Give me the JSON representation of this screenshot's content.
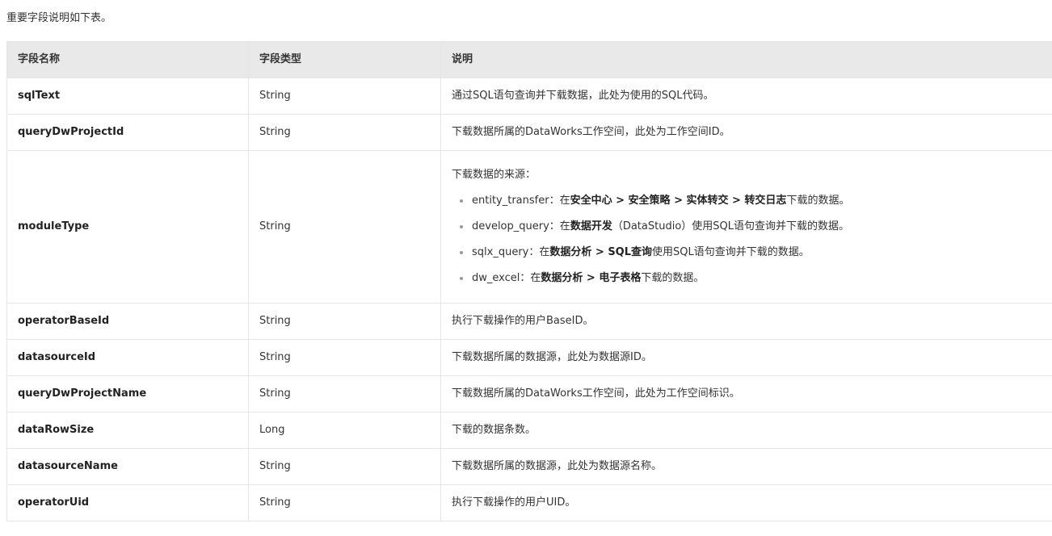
{
  "intro": "重要字段说明如下表。",
  "table": {
    "headers": [
      "字段名称",
      "字段类型",
      "说明"
    ],
    "rows": [
      {
        "name": "sqlText",
        "type": "String",
        "desc": "通过SQL语句查询并下载数据，此处为使用的SQL代码。"
      },
      {
        "name": "queryDwProjectId",
        "type": "String",
        "desc": "下载数据所属的DataWorks工作空间，此处为工作空间ID。"
      },
      {
        "name": "moduleType",
        "type": "String",
        "desc_lead": "下载数据的来源：",
        "items": [
          {
            "key": "entity_transfer：",
            "pre": "在",
            "b1": "安全中心 > 安全策略 > 实体转交 > 转交日志",
            "mid": "",
            "b2": "",
            "post": "下载的数据。"
          },
          {
            "key": "develop_query：",
            "pre": "在",
            "b1": "数据开发",
            "mid": "（DataStudio）使用SQL语句查询并下载的数据。",
            "b2": "",
            "post": ""
          },
          {
            "key": "sqlx_query：",
            "pre": "在",
            "b1": "数据分析 > SQL查询",
            "mid": "使用SQL语句查询并下载的数据。",
            "b2": "",
            "post": ""
          },
          {
            "key": "dw_excel：",
            "pre": "在",
            "b1": "数据分析 > 电子表格",
            "mid": "下载的数据。",
            "b2": "",
            "post": ""
          }
        ]
      },
      {
        "name": "operatorBaseId",
        "type": "String",
        "desc": "执行下载操作的用户BaseID。"
      },
      {
        "name": "datasourceId",
        "type": "String",
        "desc": "下载数据所属的数据源，此处为数据源ID。"
      },
      {
        "name": "queryDwProjectName",
        "type": "String",
        "desc": "下载数据所属的DataWorks工作空间，此处为工作空间标识。"
      },
      {
        "name": "dataRowSize",
        "type": "Long",
        "desc": "下载的数据条数。"
      },
      {
        "name": "datasourceName",
        "type": "String",
        "desc": "下载数据所属的数据源，此处为数据源名称。"
      },
      {
        "name": "operatorUid",
        "type": "String",
        "desc": "执行下载操作的用户UID。"
      }
    ]
  }
}
